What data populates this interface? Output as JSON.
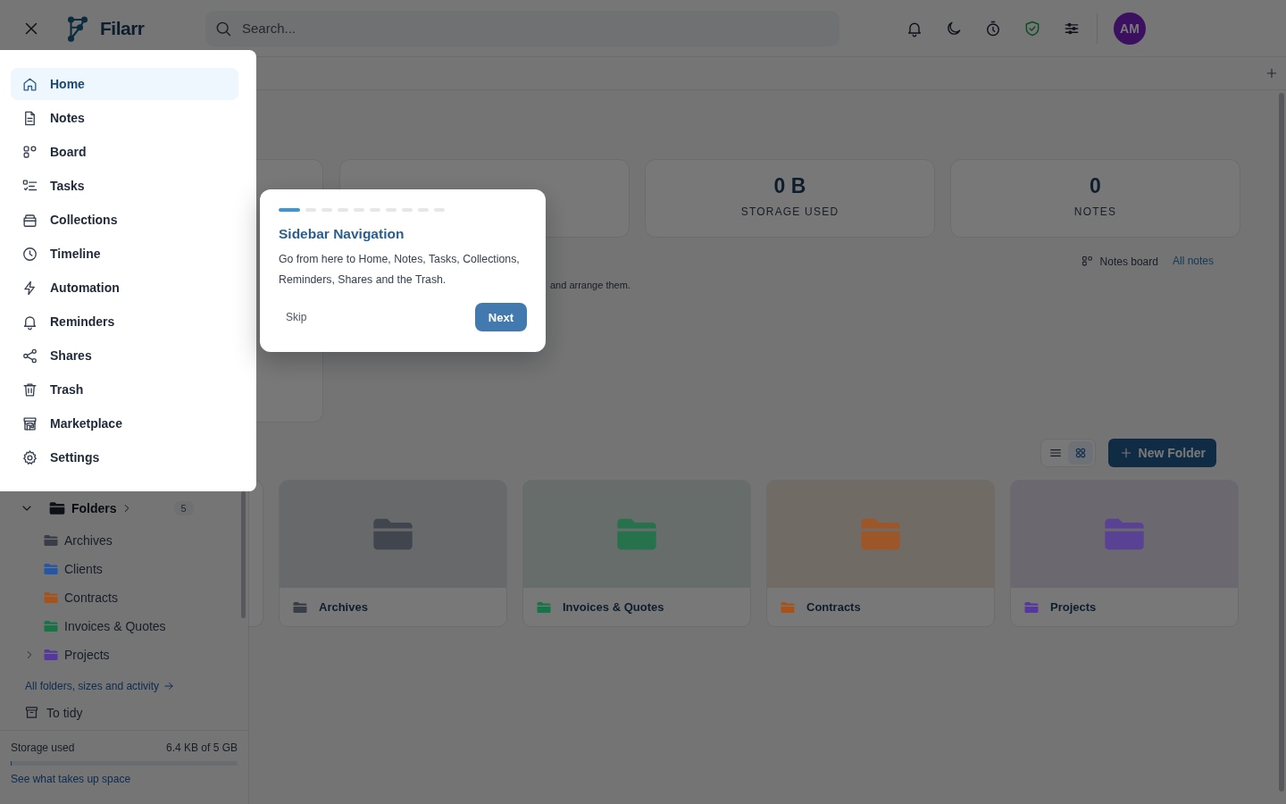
{
  "header": {
    "app_name": "Filarr",
    "search": {
      "placeholder": "Search..."
    },
    "avatar": "AM"
  },
  "nav": [
    {
      "label": "Home",
      "selected": true
    },
    {
      "label": "Notes",
      "selected": false
    },
    {
      "label": "Board",
      "selected": false
    },
    {
      "label": "Tasks",
      "selected": false
    },
    {
      "label": "Collections",
      "selected": false
    },
    {
      "label": "Timeline",
      "selected": false
    },
    {
      "label": "Automation",
      "selected": false
    },
    {
      "label": "Reminders",
      "selected": false
    },
    {
      "label": "Shares",
      "selected": false
    },
    {
      "label": "Trash",
      "selected": false
    },
    {
      "label": "Marketplace",
      "selected": false
    },
    {
      "label": "Settings",
      "selected": false
    }
  ],
  "folders_tree": {
    "label": "Folders",
    "count": "5",
    "expanded": true,
    "children": [
      {
        "label": "Archives",
        "color": "#383d48",
        "kind": "leaf"
      },
      {
        "label": "Clients",
        "color": "#2456a8",
        "kind": "leaf"
      },
      {
        "label": "Contracts",
        "color": "#a8521a",
        "kind": "leaf"
      },
      {
        "label": "Invoices & Quotes",
        "color": "#167446",
        "kind": "leaf"
      },
      {
        "label": "Projects",
        "color": "#55389e",
        "kind": "collapsed"
      }
    ]
  },
  "all_folders_link": "All folders, sizes and activity",
  "to_tidy": "To tidy",
  "storage": {
    "label": "Storage used",
    "reading": "6.4 KB of 5 GB",
    "level": 0.002,
    "link": "See what takes up space"
  },
  "stats": [
    {
      "value": "0 B",
      "label": "STORAGE USED"
    },
    {
      "value": "0",
      "label": "NOTES"
    }
  ],
  "notes_links": {
    "board": "Notes board",
    "all": "All notes"
  },
  "notes_hint": "and arrange them.",
  "view_toggle": [
    {
      "kind": "list",
      "selected": false
    },
    {
      "kind": "grid",
      "selected": true
    }
  ],
  "new_folder": "New Folder",
  "folder_cards": [
    {
      "name": "Archives",
      "color": "#383d48"
    },
    {
      "name": "Invoices & Quotes",
      "color": "#167446"
    },
    {
      "name": "Contracts",
      "color": "#a8521a"
    },
    {
      "name": "Projects",
      "color": "#55389e"
    }
  ],
  "tour": {
    "steps": [
      {
        "selected": true
      },
      {
        "selected": false
      },
      {
        "selected": false
      },
      {
        "selected": false
      },
      {
        "selected": false
      },
      {
        "selected": false
      },
      {
        "selected": false
      },
      {
        "selected": false
      },
      {
        "selected": false
      },
      {
        "selected": false
      }
    ],
    "title": "Sidebar Navigation",
    "text": "Go from here to Home, Notes, Tasks, Collections, Reminders, Shares and the Trash.",
    "skip": "Skip",
    "next": "Next"
  }
}
